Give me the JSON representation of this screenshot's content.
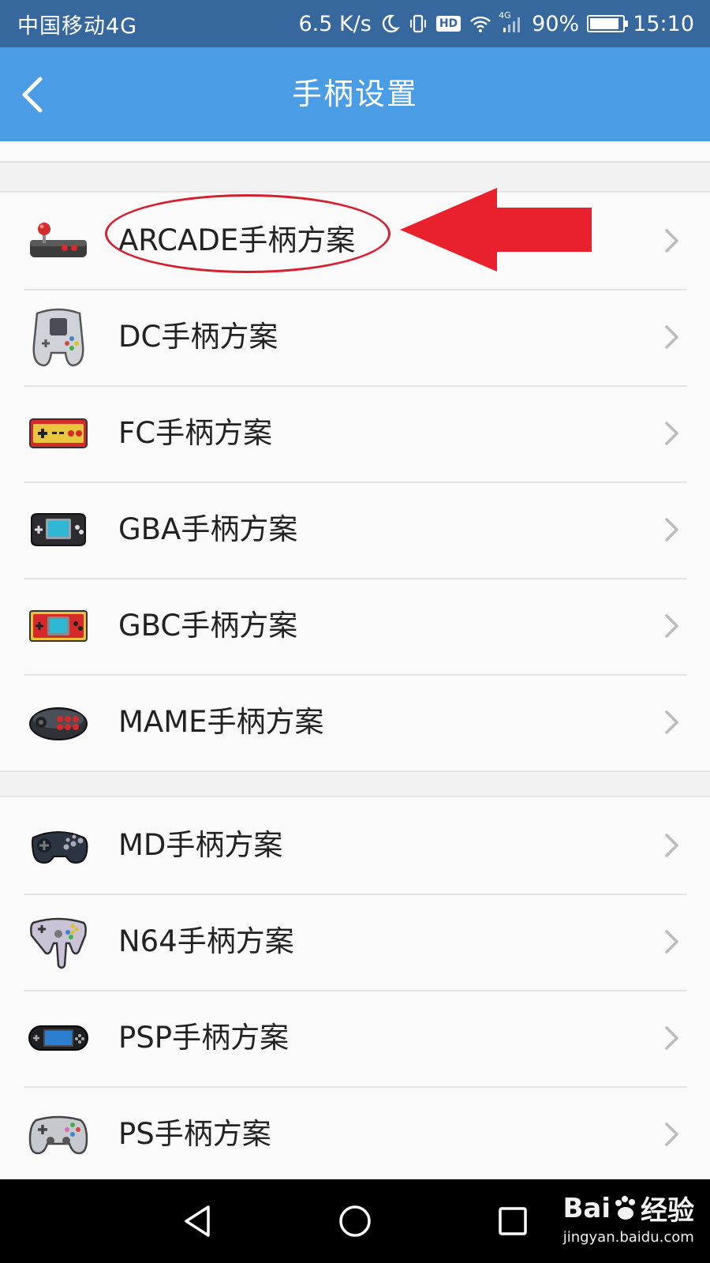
{
  "status_bar": {
    "carrier": "中国移动4G",
    "speed": "6.5 K/s",
    "hd": "HD",
    "network": "4G",
    "battery": "90%",
    "battery_level": 0.9,
    "time": "15:10"
  },
  "header": {
    "title": "手柄设置",
    "back_icon": "chevron-left-icon"
  },
  "groups": [
    {
      "items": [
        {
          "label": "ARCADE手柄方案",
          "icon": "arcade-joystick-icon"
        },
        {
          "label": "DC手柄方案",
          "icon": "dreamcast-controller-icon"
        },
        {
          "label": "FC手柄方案",
          "icon": "famicom-controller-icon"
        },
        {
          "label": "GBA手柄方案",
          "icon": "gba-console-icon"
        },
        {
          "label": "GBC手柄方案",
          "icon": "gbc-console-icon"
        },
        {
          "label": "MAME手柄方案",
          "icon": "mame-pad-icon"
        }
      ]
    },
    {
      "items": [
        {
          "label": "MD手柄方案",
          "icon": "megadrive-controller-icon"
        },
        {
          "label": "N64手柄方案",
          "icon": "n64-controller-icon"
        },
        {
          "label": "PSP手柄方案",
          "icon": "psp-console-icon"
        },
        {
          "label": "PS手柄方案",
          "icon": "ps-controller-icon"
        }
      ]
    }
  ],
  "annotation": {
    "highlight_color": "#d4202f",
    "arrow_color": "#e8212d"
  },
  "nav_bar": {
    "back": "triangle-back-icon",
    "home": "circle-home-icon",
    "recents": "square-recents-icon"
  },
  "watermark": {
    "brand_prefix": "Bai",
    "brand_suffix": "经验",
    "url": "jingyan.baidu.com"
  },
  "colors": {
    "status_bar": "#36689e",
    "app_bar": "#4a9de4",
    "list_bg": "#fafafa",
    "page_bg": "#f2f2f2"
  }
}
